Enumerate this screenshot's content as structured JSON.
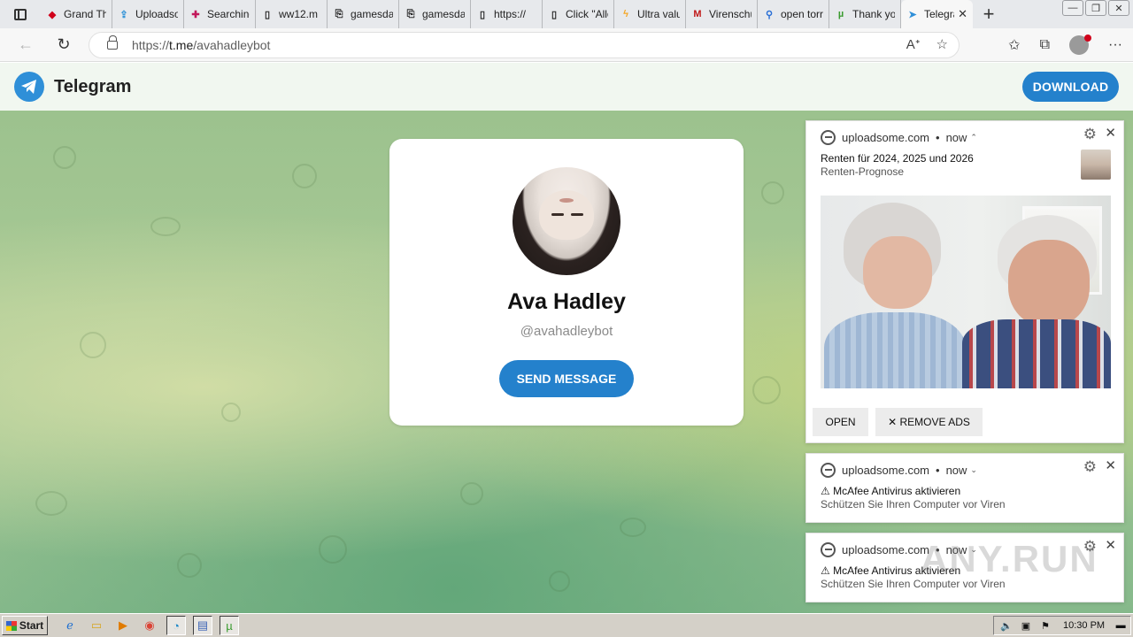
{
  "browser": {
    "tabs": [
      {
        "title": "Grand Theft",
        "icon": "red-app-icon",
        "color": "#d0021b"
      },
      {
        "title": "Uploadsome",
        "icon": "upload-icon",
        "color": "#2a8fd6"
      },
      {
        "title": "Searching",
        "icon": "slack-icon",
        "color": "#c2185b"
      },
      {
        "title": "ww12.m",
        "icon": "page-icon",
        "color": "#333333"
      },
      {
        "title": "gamesdata",
        "icon": "download-page-icon",
        "color": "#333333"
      },
      {
        "title": "gamesdata",
        "icon": "download-page-icon",
        "color": "#333333"
      },
      {
        "title": "https://",
        "icon": "page-icon",
        "color": "#333333"
      },
      {
        "title": "Click \"Allow\"",
        "icon": "page-icon",
        "color": "#333333"
      },
      {
        "title": "Ultra value",
        "icon": "lightning-icon",
        "color": "#f5a623"
      },
      {
        "title": "Virenschutz",
        "icon": "mcafee-icon",
        "color": "#c01818"
      },
      {
        "title": "open torrent",
        "icon": "search-icon",
        "color": "#2a6fd6"
      },
      {
        "title": "Thank you",
        "icon": "utorrent-icon",
        "color": "#3a9b2f"
      },
      {
        "title": "Telegram",
        "icon": "telegram-icon",
        "color": "#2f8fd8",
        "active": true
      }
    ],
    "url_prefix": "https://",
    "url_domain": "t.me",
    "url_path": "/avahadleybot"
  },
  "telegram": {
    "brand": "Telegram",
    "download_label": "DOWNLOAD",
    "profile_name": "Ava Hadley",
    "profile_handle": "@avahadleybot",
    "send_label": "SEND MESSAGE"
  },
  "notifications": [
    {
      "source": "uploadsome.com",
      "time": "now",
      "expanded": true,
      "title": "Renten für 2024, 2025 und 2026",
      "body": "Renten-Prognose",
      "open_label": "OPEN",
      "remove_label": "✕ REMOVE ADS"
    },
    {
      "source": "uploadsome.com",
      "time": "now",
      "expanded": false,
      "title": "⚠ McAfee Antivirus aktivieren",
      "body": "Schützen Sie Ihren Computer vor Viren"
    },
    {
      "source": "uploadsome.com",
      "time": "now",
      "expanded": false,
      "title": "⚠ McAfee Antivirus aktivieren",
      "body": "Schützen Sie Ihren Computer vor Viren"
    }
  ],
  "watermark": "ANY.RUN",
  "taskbar": {
    "start_label": "Start",
    "clock": "10:30 PM"
  }
}
